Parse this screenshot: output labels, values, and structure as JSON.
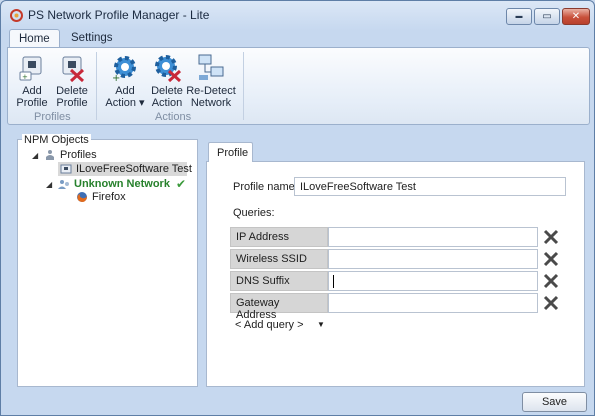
{
  "window": {
    "title": "PS Network Profile Manager - Lite",
    "controls": {
      "minimize": "▬",
      "maximize": "▭",
      "close": "✕"
    }
  },
  "ribbon": {
    "tabs": [
      {
        "label": "Home",
        "active": true
      },
      {
        "label": "Settings",
        "active": false
      }
    ],
    "groups": [
      {
        "label": "Profiles",
        "buttons": [
          {
            "label1": "Add",
            "label2": "Profile",
            "icon": "add-profile-icon"
          },
          {
            "label1": "Delete",
            "label2": "Profile",
            "icon": "delete-profile-icon"
          }
        ]
      },
      {
        "label": "Actions",
        "buttons": [
          {
            "label1": "Add",
            "label2": "Action ▾",
            "icon": "gear-add-icon"
          },
          {
            "label1": "Delete",
            "label2": "Action",
            "icon": "gear-delete-icon"
          },
          {
            "label1": "Re-Detect",
            "label2": "Network",
            "icon": "network-icon"
          }
        ]
      }
    ]
  },
  "tree": {
    "group_title": "NPM Objects",
    "items": [
      {
        "label": "Profiles",
        "expander": "◢",
        "icon": "profiles-icon"
      },
      {
        "label": "ILoveFreeSoftware Test",
        "icon": "profile-icon",
        "selected": true
      },
      {
        "label": "Unknown Network",
        "expander": "◢",
        "icon": "network-user-icon",
        "status": "✔"
      },
      {
        "label": "Firefox",
        "icon": "firefox-icon"
      }
    ]
  },
  "profile_panel": {
    "tab_label": "Profile",
    "name_label": "Profile name:",
    "name_value": "ILoveFreeSoftware Test",
    "queries_label": "Queries:",
    "queries": [
      {
        "key": "IP Address",
        "value": ""
      },
      {
        "key": "Wireless SSID",
        "value": ""
      },
      {
        "key": "DNS Suffix",
        "value": ""
      },
      {
        "key": "Gateway Address",
        "value": ""
      }
    ],
    "add_query": "< Add query >",
    "add_query_arrow": "▼"
  },
  "footer": {
    "save_label": "Save"
  },
  "colors": {
    "accent": "#27812c",
    "window_bg": "#c6d8ef",
    "close": "#c8503b"
  }
}
